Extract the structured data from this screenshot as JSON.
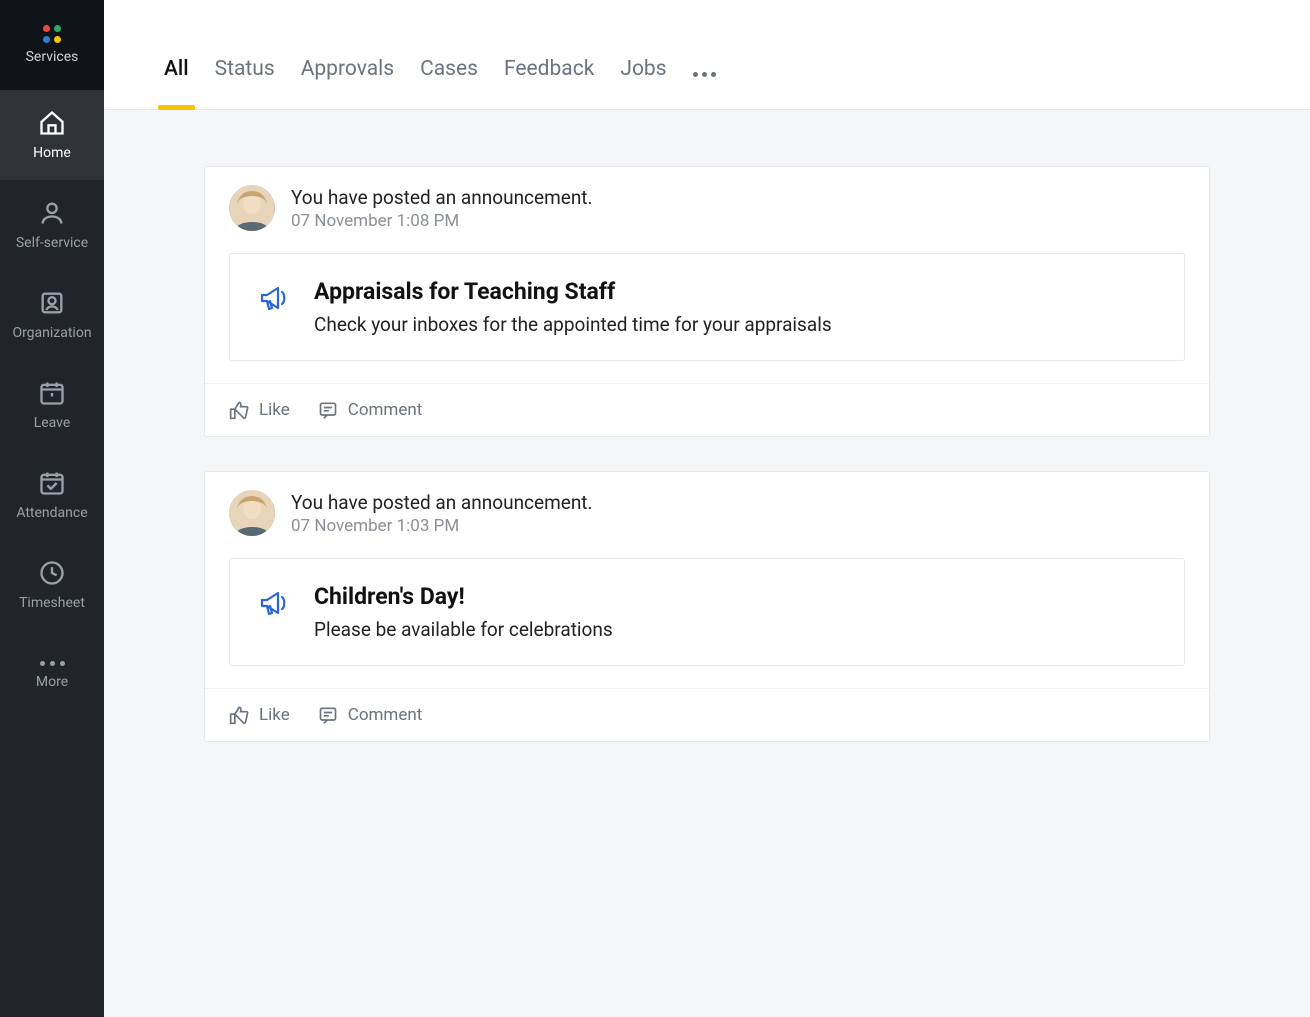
{
  "sidebar": {
    "services_label": "Services",
    "items": [
      {
        "id": "home",
        "label": "Home",
        "icon": "home-icon",
        "active": true
      },
      {
        "id": "self-service",
        "label": "Self-service",
        "icon": "user-icon",
        "active": false
      },
      {
        "id": "organization",
        "label": "Organization",
        "icon": "org-icon",
        "active": false
      },
      {
        "id": "leave",
        "label": "Leave",
        "icon": "calendar-alert-icon",
        "active": false
      },
      {
        "id": "attendance",
        "label": "Attendance",
        "icon": "calendar-check-icon",
        "active": false
      },
      {
        "id": "timesheet",
        "label": "Timesheet",
        "icon": "clock-icon",
        "active": false
      }
    ],
    "more_label": "More"
  },
  "tabs": {
    "items": [
      {
        "id": "all",
        "label": "All",
        "active": true
      },
      {
        "id": "status",
        "label": "Status",
        "active": false
      },
      {
        "id": "approvals",
        "label": "Approvals",
        "active": false
      },
      {
        "id": "cases",
        "label": "Cases",
        "active": false
      },
      {
        "id": "feedback",
        "label": "Feedback",
        "active": false
      },
      {
        "id": "jobs",
        "label": "Jobs",
        "active": false
      }
    ]
  },
  "actions": {
    "like_label": "Like",
    "comment_label": "Comment"
  },
  "feed": [
    {
      "header_text": "You have posted an announcement.",
      "timestamp": "07 November 1:08 PM",
      "announcement": {
        "title": "Appraisals for Teaching Staff",
        "body": "Check your inboxes for the appointed time for your appraisals"
      }
    },
    {
      "header_text": "You have posted an announcement.",
      "timestamp": "07 November 1:03 PM",
      "announcement": {
        "title": "Children's Day!",
        "body": "Please be available for celebrations"
      }
    }
  ],
  "colors": {
    "accent_yellow": "#f6c500",
    "icon_blue": "#2a66d6",
    "sidebar_bg": "#20252b"
  }
}
